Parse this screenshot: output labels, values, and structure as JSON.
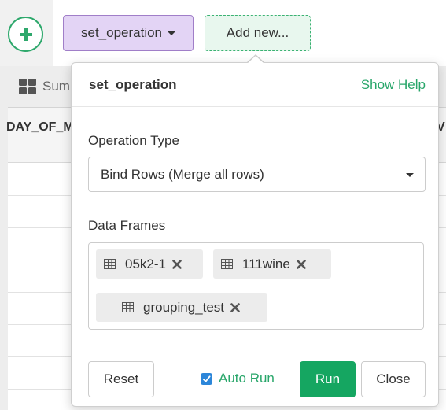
{
  "toolbar": {
    "step_label": "set_operation",
    "add_new_label": "Add new..."
  },
  "background": {
    "summary_tab_label": "Sum",
    "column_headers": [
      "DAY_OF_M",
      "V"
    ]
  },
  "popover": {
    "title": "set_operation",
    "help_link": "Show Help",
    "operation_type_label": "Operation Type",
    "operation_type_value": "Bind Rows (Merge all rows)",
    "data_frames_label": "Data Frames",
    "data_frames": [
      "05k2-1",
      "111wine",
      "grouping_test"
    ],
    "reset_label": "Reset",
    "auto_run_label": "Auto Run",
    "auto_run_checked": true,
    "run_label": "Run",
    "close_label": "Close"
  },
  "colors": {
    "accent_green": "#15a661",
    "step_purple": "#e3d4f5",
    "checkbox_blue": "#2c86d9"
  }
}
